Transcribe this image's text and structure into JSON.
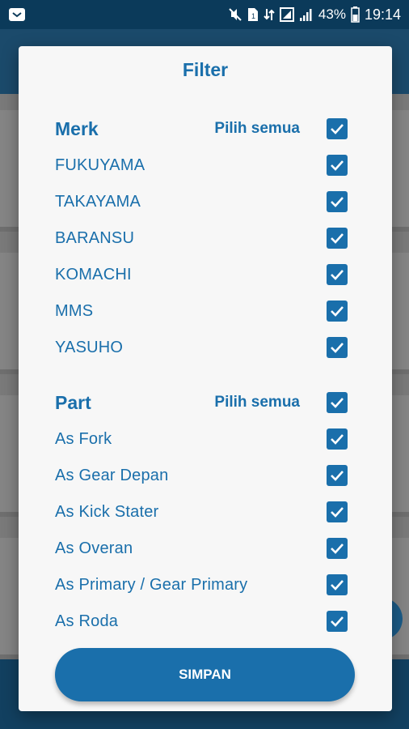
{
  "status_bar": {
    "battery_percent": "43%",
    "time": "19:14"
  },
  "dialog": {
    "title": "Filter",
    "sections": [
      {
        "title": "Merk",
        "select_all_label": "Pilih semua",
        "select_all_checked": true,
        "items": [
          {
            "label": "FUKUYAMA",
            "checked": true
          },
          {
            "label": "TAKAYAMA",
            "checked": true
          },
          {
            "label": "BARANSU",
            "checked": true
          },
          {
            "label": "KOMACHI",
            "checked": true
          },
          {
            "label": "MMS",
            "checked": true
          },
          {
            "label": "YASUHO",
            "checked": true
          }
        ]
      },
      {
        "title": "Part",
        "select_all_label": "Pilih semua",
        "select_all_checked": true,
        "items": [
          {
            "label": "As Fork",
            "checked": true
          },
          {
            "label": "As Gear Depan",
            "checked": true
          },
          {
            "label": "As Kick Stater",
            "checked": true
          },
          {
            "label": "As Overan",
            "checked": true
          },
          {
            "label": "As Primary / Gear Primary",
            "checked": true
          },
          {
            "label": "As Roda",
            "checked": true
          }
        ]
      }
    ],
    "save_label": "SIMPAN"
  },
  "colors": {
    "accent": "#1a6fab",
    "status_bar": "#0b3a5a",
    "dialog_bg": "#f7f7f7"
  }
}
